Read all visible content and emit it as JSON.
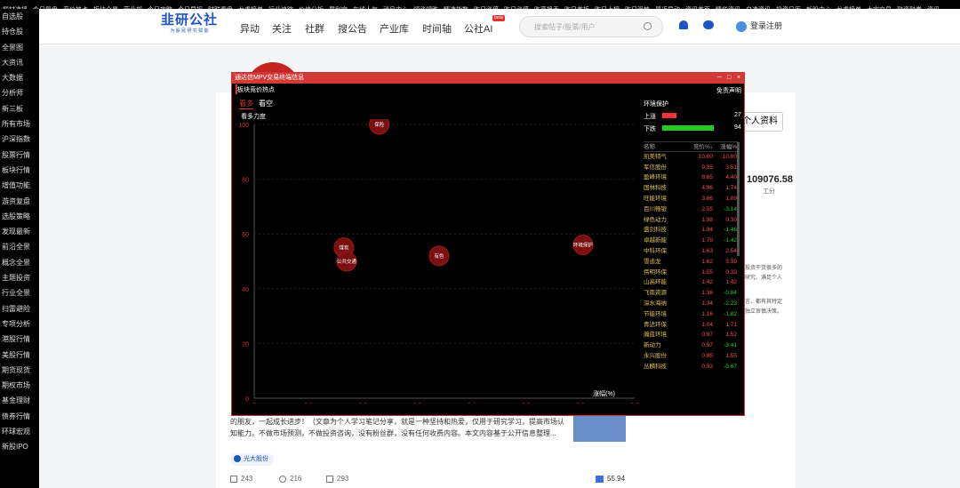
{
  "topbar": {
    "items": [
      "题材选择",
      "今日复盘",
      "竞价热点",
      "板块全景",
      "营业部",
      "今日攻略",
      "今日早报",
      "财联看盘",
      "龙虎榜单",
      "行业追踪",
      "价值分析",
      "犀利宝",
      "在线人气",
      "消息中心",
      "领涨领跌",
      "精选指数",
      "昨日涨停",
      "昨日涨停",
      "昨高换手",
      "昨日首板",
      "昨日上榜",
      "昨日强势",
      "最近异动",
      "资讯首页",
      "精华资讯",
      "自选资讯",
      "投资日历",
      "新股中心",
      "龙虎榜单",
      "大宗交易",
      "融资融券",
      "资讯"
    ]
  },
  "leftnav": {
    "items": [
      "自选股",
      "持仓股",
      "全景图",
      "大资讯",
      "大数据",
      "分析师",
      "新三板",
      "所有市场",
      "沪深指数",
      "股票行情",
      "板块行情",
      "增值功能",
      "游资复盘",
      "选股策略",
      "发现最新",
      "前沿全景",
      "概念全景",
      "主题投资",
      "行业全景",
      "扫雷避险",
      "专项分析",
      "港股行情",
      "美股行情",
      "期货现货",
      "期权市场",
      "基金理财",
      "债券行情",
      "环球宏观",
      "新股IPO"
    ]
  },
  "header": {
    "logo": "韭研公社",
    "slogan": "为 股 民 研 究 赋 能",
    "nav": [
      "异动",
      "关注",
      "社群",
      "搜公告",
      "产业库",
      "时间轴",
      "公社AI"
    ],
    "beta": "beta",
    "search_placeholder": "搜索帖子/股票/用户",
    "login": "登录注册"
  },
  "profile": {
    "button": "个人资料",
    "stat_value": "109076.58",
    "stat_label": "工分"
  },
  "article": {
    "side_lines": [
      "投资干货很多的",
      "研究、满足个人",
      "",
      "言、都有其特定",
      "独立审慎决策。"
    ],
    "body": "的朋友，一起成长进步！（文章为个人学习笔记分享，就是一种坚持和热爱，仅用于研究学习，提高市场认知能力。不做市场预测，不做投资咨询，没有粉丝群，没有任何收费内容。本文内容基于公开信息整理...",
    "tag": "光大股份",
    "shares": "243",
    "comments": "216",
    "likes": "293",
    "score": "55.94"
  },
  "popup": {
    "title": "通达信MPV交易终端信息",
    "subtitle": "板块竞价热点",
    "disclaimer": "免责声明",
    "tabs": [
      "看多",
      "看空"
    ],
    "chart_label": "看多力度",
    "colors": {
      "up": "#ff3333",
      "down": "#22cc22",
      "bubble": "#7a1010"
    },
    "sector": "环境保护",
    "up_label": "上涨",
    "up_count": "27",
    "down_label": "下跌",
    "down_count": "94",
    "table_headers": [
      "名称",
      "竞价%↓",
      "涨幅%"
    ],
    "table_rows": [
      [
        "凯美特气",
        "10.00",
        "10.00"
      ],
      [
        "军信股份",
        "9.35",
        "3.51"
      ],
      [
        "盈峰环境",
        "8.65",
        "4.40"
      ],
      [
        "国林科技",
        "4.96",
        "1.74"
      ],
      [
        "旺能环境",
        "3.66",
        "1.09"
      ],
      [
        "百川畅银",
        "2.55",
        "-3.14"
      ],
      [
        "绿色动力",
        "1.98",
        "0.30"
      ],
      [
        "盛剑科技",
        "1.84",
        "-1.46"
      ],
      [
        "卓越新能",
        "1.79",
        "-1.42"
      ],
      [
        "中科环保",
        "1.63",
        "2.54"
      ],
      [
        "雪迪龙",
        "1.62",
        "3.39"
      ],
      [
        "伟明环保",
        "1.55",
        "0.33"
      ],
      [
        "山高环能",
        "1.42",
        "1.42"
      ],
      [
        "飞南资源",
        "1.36",
        "-0.84"
      ],
      [
        "深水海纳",
        "1.34",
        "-2.23"
      ],
      [
        "节能环境",
        "1.16",
        "-1.82"
      ],
      [
        "青达环保",
        "1.04",
        "1.71"
      ],
      [
        "瀚蓝环境",
        "0.97",
        "1.52"
      ],
      [
        "新动力",
        "0.97",
        "-3.41"
      ],
      [
        "永兴股份",
        "0.95",
        "1.55"
      ],
      [
        "丛麟科技",
        "0.93",
        "-0.67"
      ]
    ]
  },
  "chart_data": {
    "type": "scatter",
    "title": "看多力度",
    "xlabel": "涨幅(%)",
    "xlim": [
      0,
      0.7
    ],
    "ylim": [
      0,
      100
    ],
    "xticks": [
      "0",
      "0.1",
      "0.2",
      "0.3",
      "0.4",
      "0.5",
      "0.6",
      "0.7"
    ],
    "yticks": [
      "0",
      "20",
      "40",
      "60",
      "80",
      "100"
    ],
    "points": [
      {
        "label": "保险",
        "x": 0.23,
        "y": 100
      },
      {
        "label": "煤炭",
        "x": 0.165,
        "y": 55
      },
      {
        "label": "公共交通",
        "x": 0.17,
        "y": 50
      },
      {
        "label": "有色",
        "x": 0.34,
        "y": 52
      },
      {
        "label": "环境保护",
        "x": 0.605,
        "y": 56
      }
    ]
  }
}
